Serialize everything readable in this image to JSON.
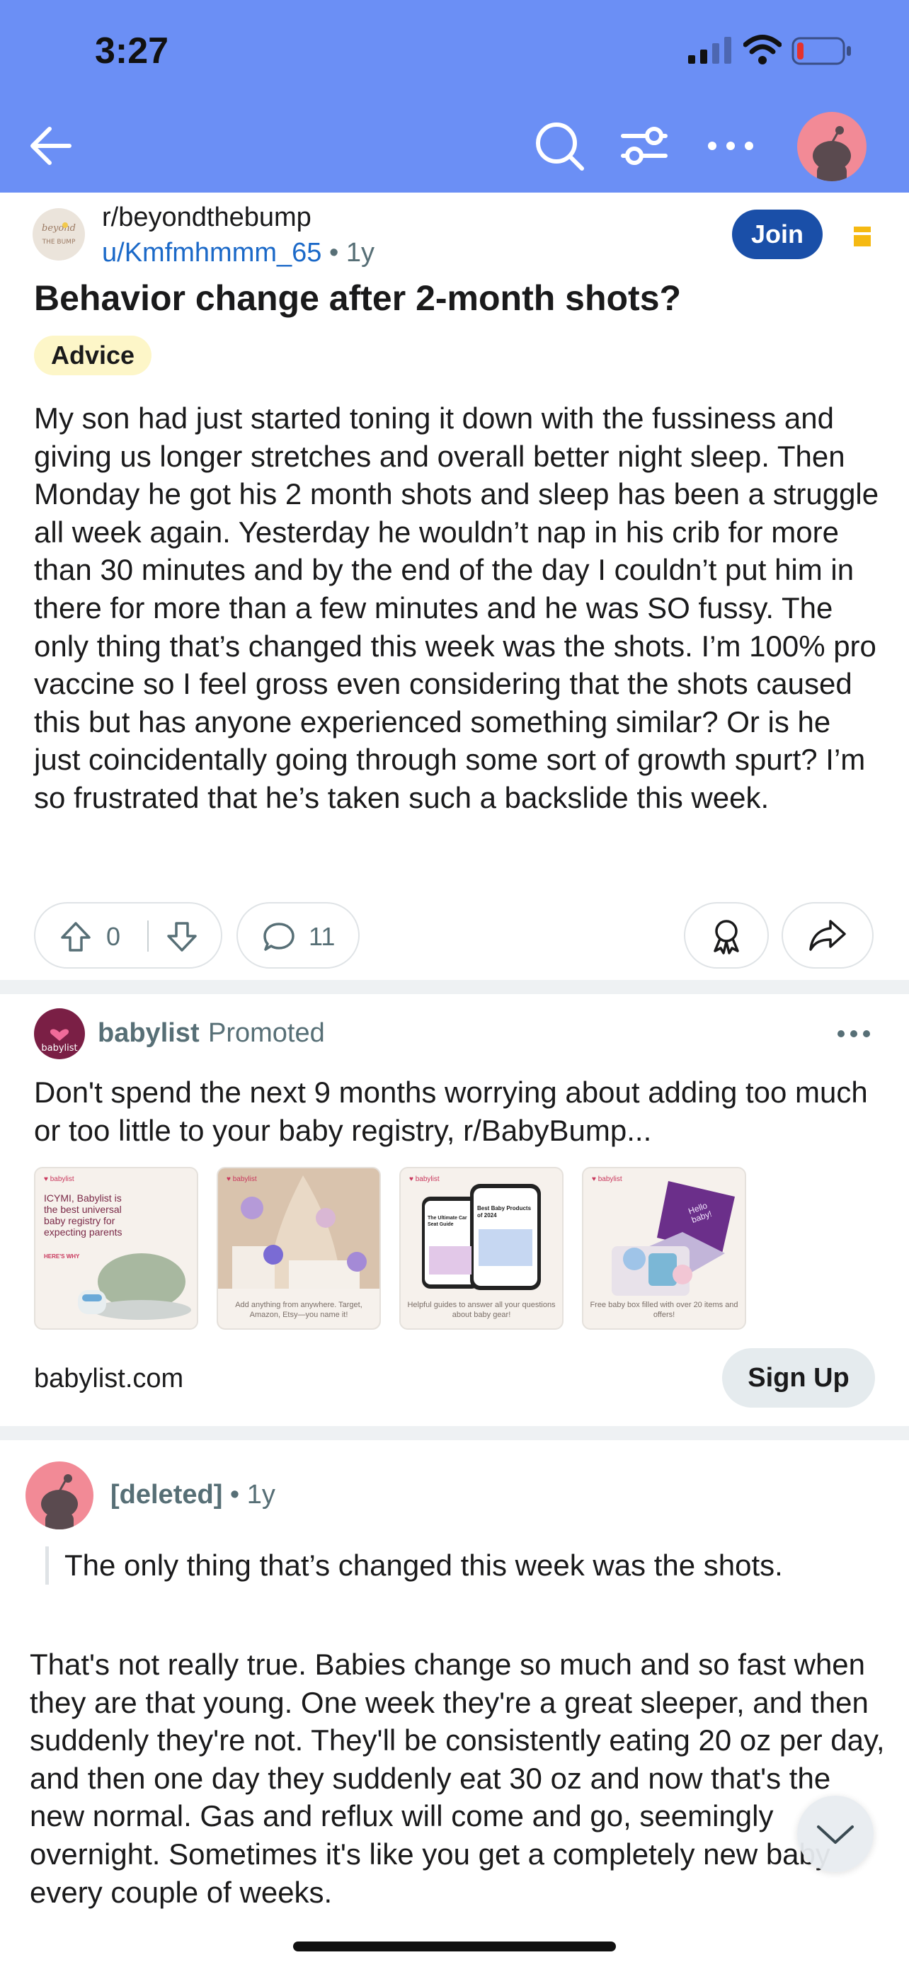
{
  "status_bar": {
    "time": "3:27"
  },
  "header": {
    "back_icon": "arrow-left-icon",
    "search_icon": "search-icon",
    "filter_icon": "sliders-icon",
    "more_icon": "ellipsis-icon",
    "avatar_icon": "snoo-avatar"
  },
  "post": {
    "subreddit": "r/beyondthebump",
    "subreddit_icon_text": "beyond the bump",
    "author": "u/Kmfmhmmm_65",
    "separator": "•",
    "age": "1y",
    "join_label": "Join",
    "title": "Behavior change after 2-month shots?",
    "flair": "Advice",
    "body": "My son had just started toning it down with the fussiness and giving us longer stretches and overall better night sleep. Then Monday he got his 2 month shots and sleep has been a struggle all week again. Yesterday he wouldn’t nap in his crib for more than 30 minutes and by the end of the day I couldn’t put him in there for more than a few minutes and he was SO fussy. The only thing that’s changed this week was the shots. I’m 100% pro vaccine so I feel gross even considering that the shots caused this but has anyone experienced something similar? Or is he just coincidentally going through some sort of growth spurt? I’m so frustrated that he’s taken such a backslide this week.",
    "votes": "0",
    "comments": "11"
  },
  "ad": {
    "advertiser": "babylist",
    "logo_text": "babylist",
    "promoted_label": "Promoted",
    "text": "Don't spend the next 9 months worrying about adding too much or too little to your baby registry, r/BabyBump...",
    "cards": [
      {
        "brand": "♥ babylist",
        "headline": "ICYMI, Babylist is the best universal baby registry for expecting parents",
        "link": "HERE'S WHY",
        "caption": ""
      },
      {
        "brand": "♥ babylist",
        "headline": "",
        "link": "",
        "caption": "Add anything from anywhere. Target, Amazon, Etsy—you name it!"
      },
      {
        "brand": "♥ babylist",
        "headline": "Best Baby Products of 2024",
        "link": "The Ultimate Car Seat Guide",
        "caption": "Helpful guides to answer all your questions about baby gear!"
      },
      {
        "brand": "♥ babylist",
        "headline": "Hello baby!",
        "link": "",
        "caption": "Free baby box filled with over 20 items and offers!"
      }
    ],
    "domain": "babylist.com",
    "signup_label": "Sign Up"
  },
  "comment": {
    "author": "[deleted]",
    "separator": "•",
    "age": "1y",
    "quote": "The only thing that’s changed this week was the shots.",
    "body": "That's not really true. Babies change so much and so fast when they are that young. One week they're a great sleeper, and then suddenly they're not. They'll be consistently eating 20 oz per day, and then one day they suddenly eat 30 oz and now that's the new normal. Gas and reflux will come and go, seemingly overnight. Sometimes it's like you get a completely new baby every couple of weeks."
  },
  "colors": {
    "header_bg": "#6b8ff5",
    "join_bg": "#1a4fa8",
    "link_blue": "#1b69c8",
    "flair_bg": "#fdf6c8",
    "avatar_pink": "#f28a96",
    "babylist_maroon": "#7a1f45"
  }
}
